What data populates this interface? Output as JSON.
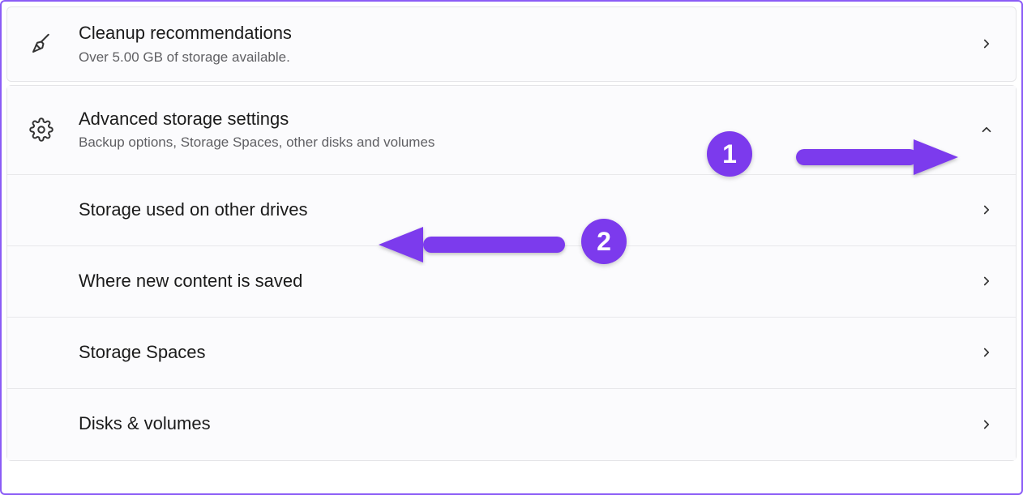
{
  "cleanup": {
    "title": "Cleanup recommendations",
    "subtitle": "Over 5.00 GB of storage available."
  },
  "advanced": {
    "title": "Advanced storage settings",
    "subtitle": "Backup options, Storage Spaces, other disks and volumes"
  },
  "subitems": {
    "storage_other": "Storage used on other drives",
    "new_content": "Where new content is saved",
    "storage_spaces": "Storage Spaces",
    "disks_volumes": "Disks & volumes"
  },
  "annotations": {
    "badge1": "1",
    "badge2": "2"
  }
}
